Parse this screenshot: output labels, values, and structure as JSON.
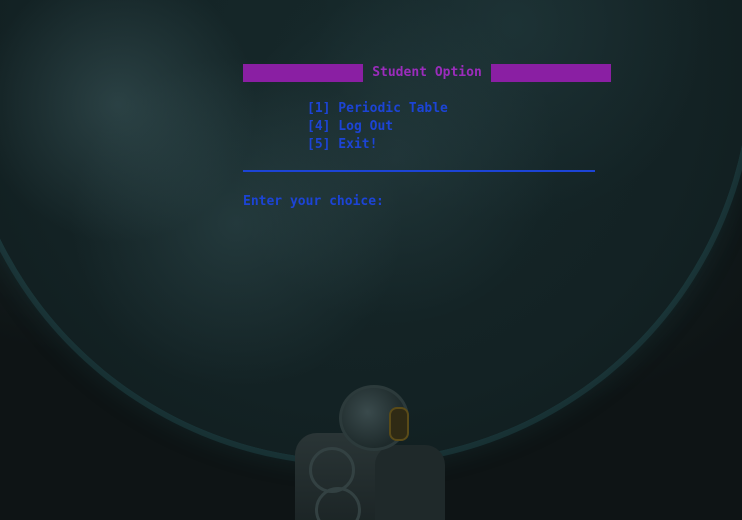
{
  "menu": {
    "title": "Student Option",
    "options": [
      {
        "label": "[1] Periodic Table"
      },
      {
        "label": "[4] Log Out"
      },
      {
        "label": "[5] Exit!"
      }
    ],
    "prompt": "Enter your choice:"
  },
  "colors": {
    "title_bar": "#8a1fa3",
    "title_text": "#9b2cbc",
    "menu_text": "#1c44d6",
    "background": "#0f1617"
  }
}
